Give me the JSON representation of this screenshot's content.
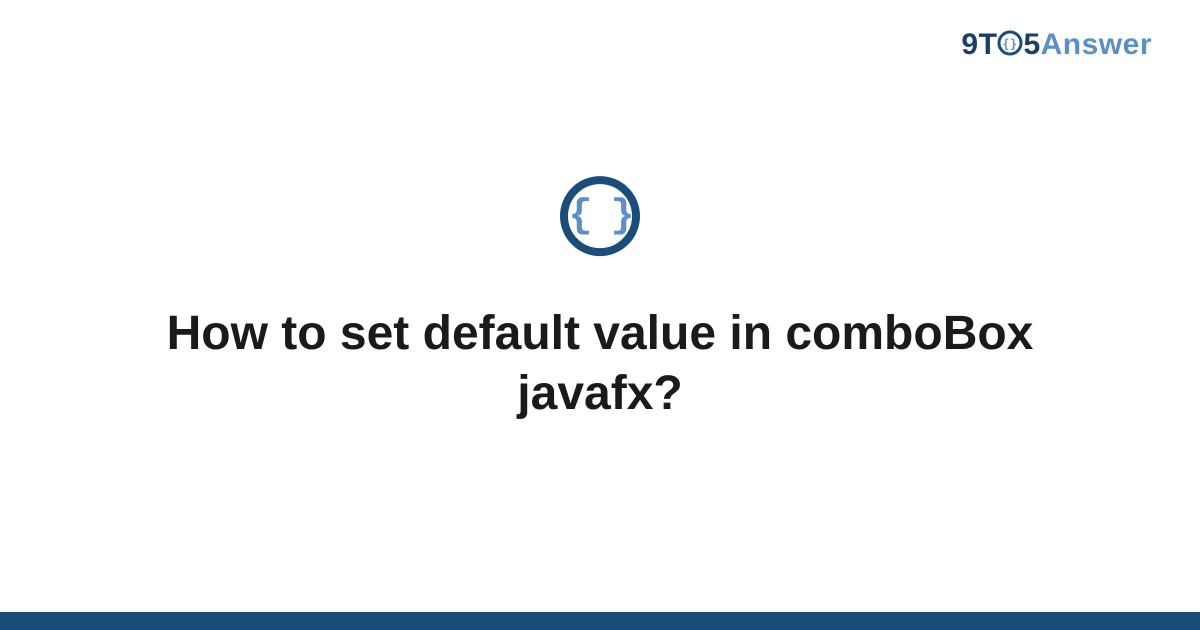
{
  "logo": {
    "part1": "9T",
    "part2": "5",
    "part3": "Answer"
  },
  "icon": {
    "glyph": "{ }",
    "name": "braces-icon"
  },
  "title": "How to set default value in comboBox javafx?",
  "colors": {
    "dark_blue": "#1a4d7a",
    "light_blue": "#5a8fc7",
    "text": "#1a1a1a"
  }
}
